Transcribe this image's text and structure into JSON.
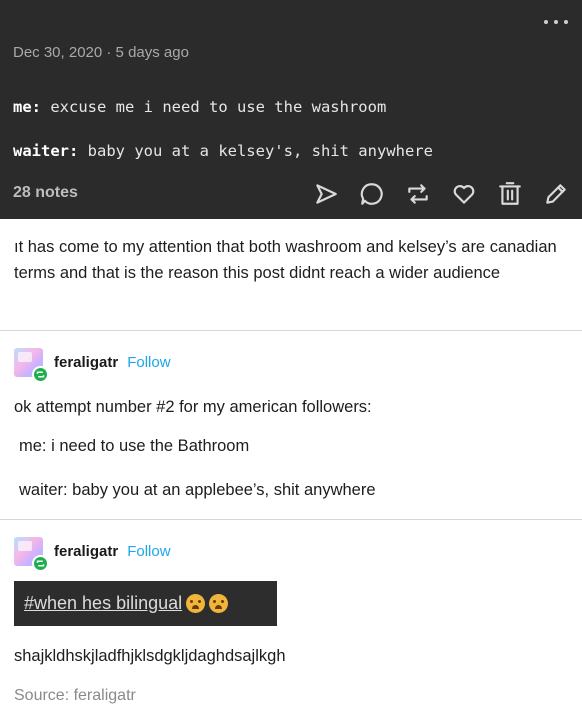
{
  "post": {
    "date": "Dec 30, 2020 · 5 days ago",
    "chat": [
      {
        "speaker": "me:",
        "text": "excuse me i need to use the washroom"
      },
      {
        "speaker": "waiter:",
        "text": "baby you at a kelsey's, shit anywhere"
      }
    ],
    "notes": "28 notes",
    "actions": [
      "share-icon",
      "reply-icon",
      "reblog-icon",
      "like-icon",
      "delete-icon",
      "edit-icon"
    ]
  },
  "reblog_1": {
    "text": "ıt has come to my attention that both washroom and kelsey’s are canadian terms and that is the reason this post didnt reach a wider audience"
  },
  "reblog_2": {
    "username": "feraligatr",
    "follow_label": "Follow",
    "intro": "ok attempt number #2 for my american followers:",
    "line_1": "me: i need to use the Bathroom",
    "line_2": "waiter: baby you at an applebee’s, shit anywhere"
  },
  "reblog_3": {
    "username": "feraligatr",
    "follow_label": "Follow",
    "tag": "#when hes bilingual",
    "tag_emoji": "weary-face-emoji",
    "text": "shajkldhskjladfhjklsdgkljdaghdsajlkgh"
  },
  "source": "Source: feraligatr",
  "colors": {
    "dark_panel": "#2b2b2b",
    "follow_blue": "#1ea7ea",
    "reblog_green": "#1fae4e"
  }
}
